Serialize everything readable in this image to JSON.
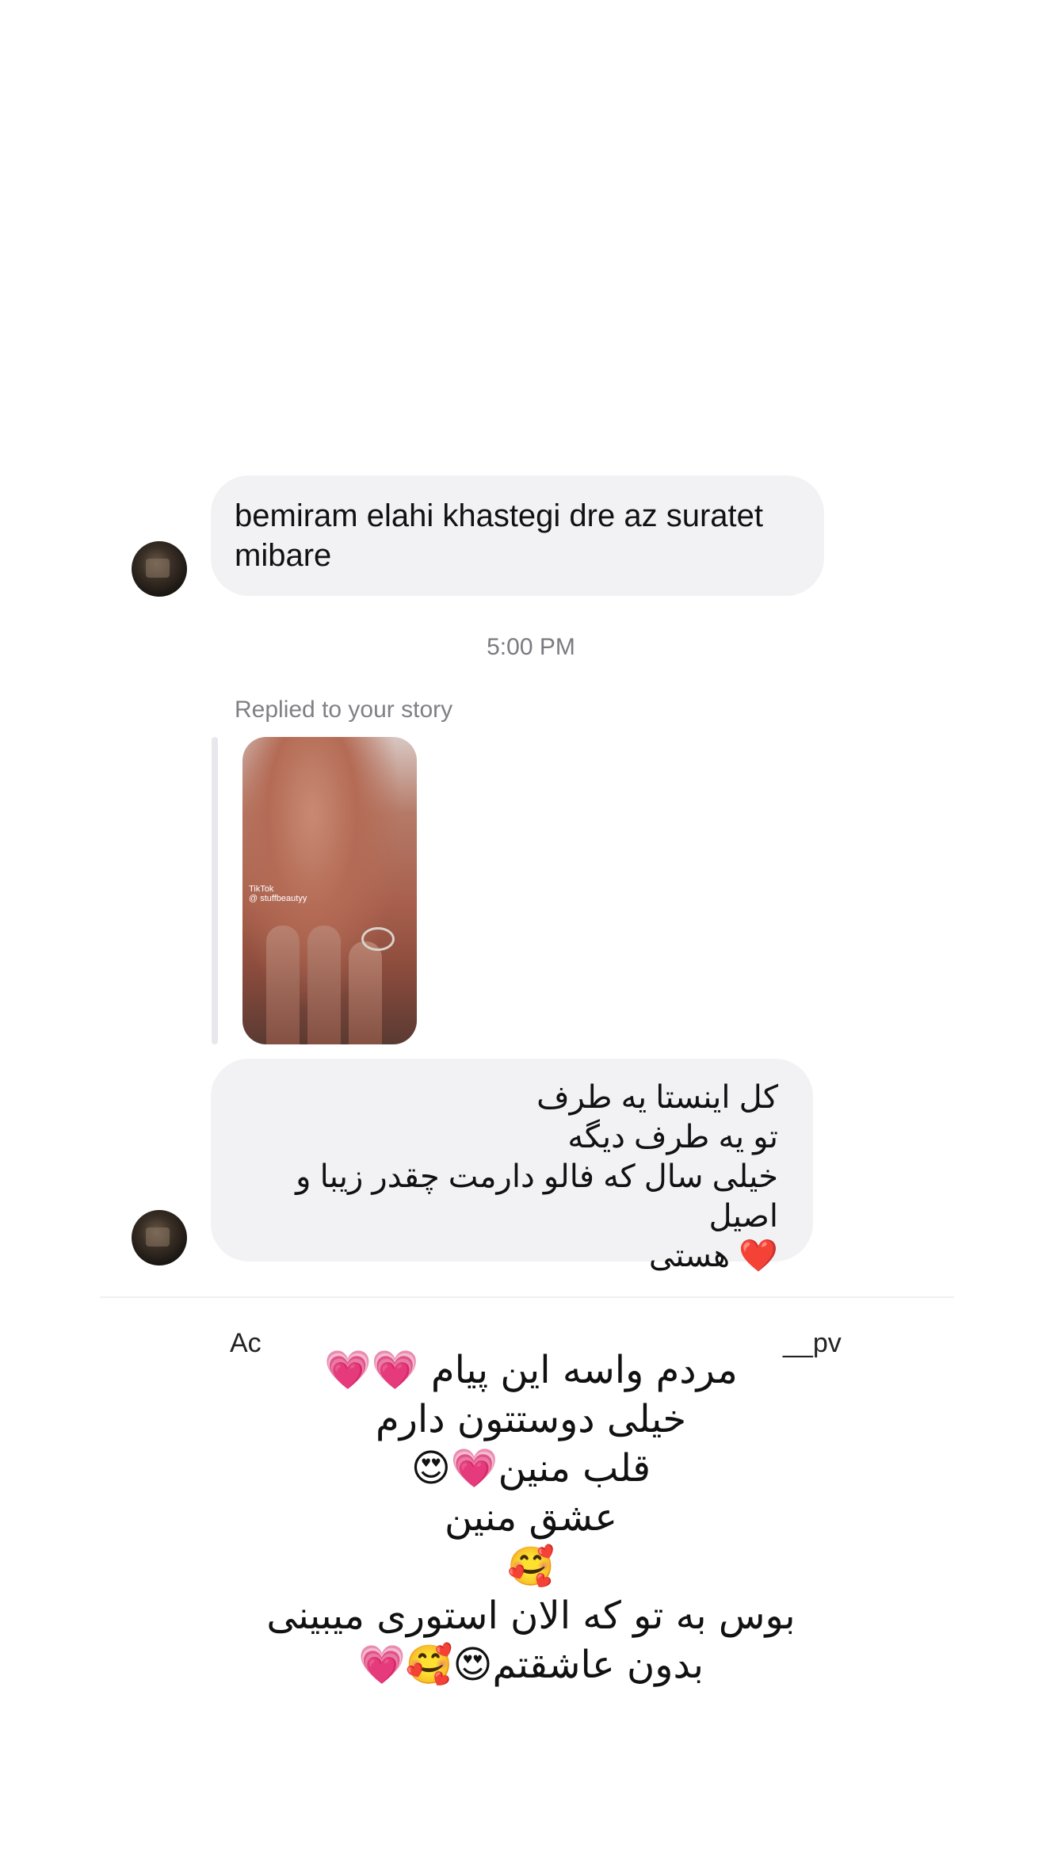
{
  "messages": [
    {
      "lines": [
        "bemiram elahi khastegi dre az suratet",
        "mibare"
      ]
    },
    {
      "lines": [
        "کل اینستا یه طرف",
        "تو یه طرف دیگه",
        "خیلی سال که فالو دارمت چقدر زیبا و اصیل",
        "❤️ هستی"
      ]
    }
  ],
  "timestamp": "5:00 PM",
  "story_reply": {
    "label": "Replied to your story",
    "watermark_line1": "TikTok",
    "watermark_line2": "@ stuffbeautyy"
  },
  "bottom_bar": {
    "left_text": "Ac",
    "right_text": "__pv"
  },
  "overlay_text": {
    "lines": [
      "مردم واسه این پیام 💗💗",
      "خیلی دوستتون دارم",
      "قلب منین💗😍",
      "عشق منین",
      "🥰",
      "بوس به تو که الان استوری میبینی",
      "بدون عاشقتم😍🥰💗"
    ]
  }
}
